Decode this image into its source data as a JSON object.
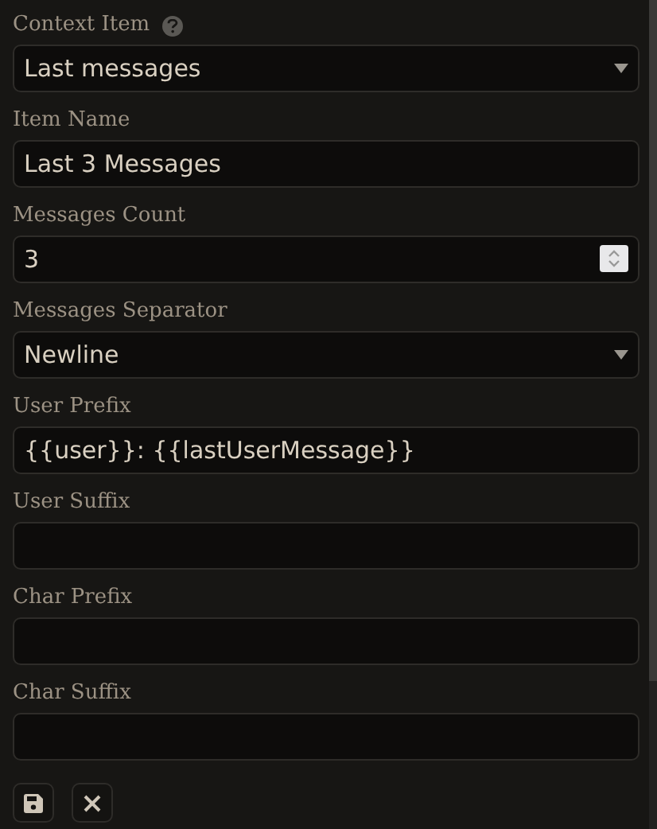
{
  "context_item": {
    "label": "Context Item",
    "kind": "select",
    "value": "Last messages"
  },
  "fields": [
    {
      "label": "Item Name",
      "kind": "text",
      "value": "Last 3 Messages"
    },
    {
      "label": "Messages Count",
      "kind": "number",
      "value": "3"
    },
    {
      "label": "Messages Separator",
      "kind": "select",
      "value": "Newline"
    },
    {
      "label": "User Prefix",
      "kind": "text",
      "value": "{{user}}: {{lastUserMessage}}"
    },
    {
      "label": "User Suffix",
      "kind": "text"
    },
    {
      "label": "Char Prefix",
      "kind": "text"
    },
    {
      "label": "Char Suffix",
      "kind": "text"
    }
  ],
  "actions": [
    {
      "kind": "save"
    },
    {
      "kind": "cancel"
    }
  ]
}
